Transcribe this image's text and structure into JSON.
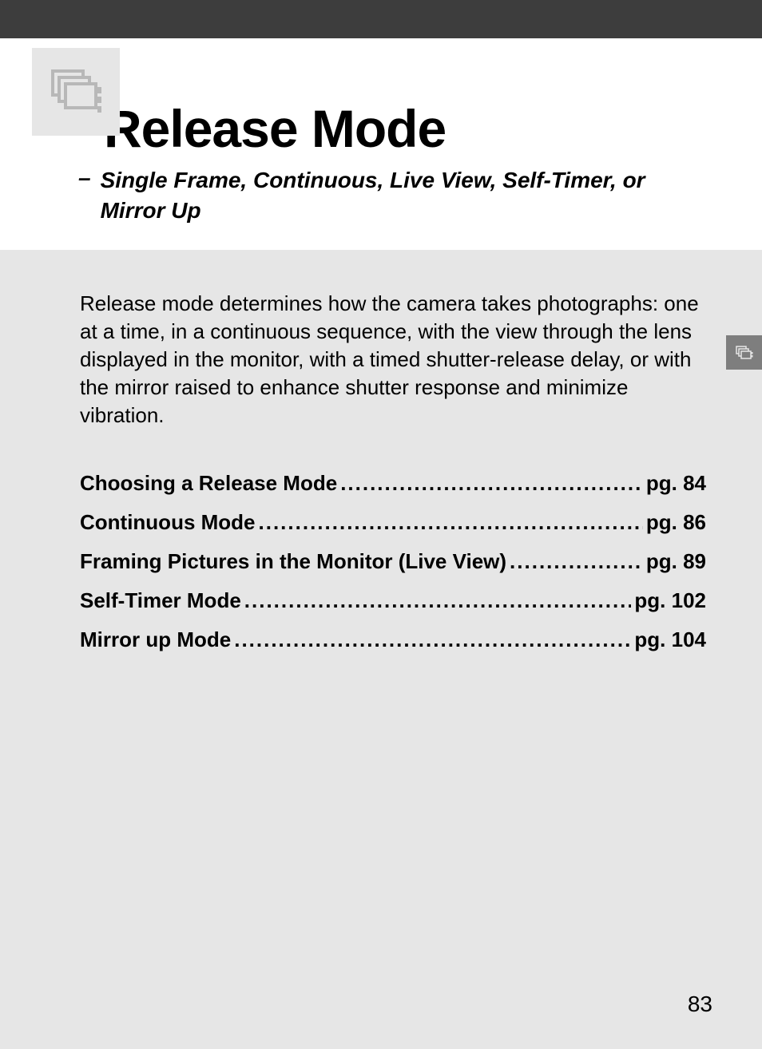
{
  "header": {
    "title": "Release Mode",
    "subtitle_dash": "–",
    "subtitle": "Single Frame, Continuous, Live View, Self-Timer, or Mirror Up"
  },
  "intro": "Release mode determines how the camera takes photographs: one at a time, in a continuous sequence, with the view through the lens displayed in the monitor, with a timed shutter-release delay, or with the mirror raised to enhance shutter response and minimize vibration.",
  "toc": [
    {
      "title": "Choosing a Release Mode",
      "page": "pg. 84"
    },
    {
      "title": "Continuous Mode",
      "page": "pg. 86"
    },
    {
      "title": "Framing Pictures in the Monitor (Live View)",
      "page": "pg. 89"
    },
    {
      "title": "Self-Timer Mode ",
      "page": " pg. 102"
    },
    {
      "title": "Mirror up Mode",
      "page": " pg. 104"
    }
  ],
  "page_number": "83"
}
